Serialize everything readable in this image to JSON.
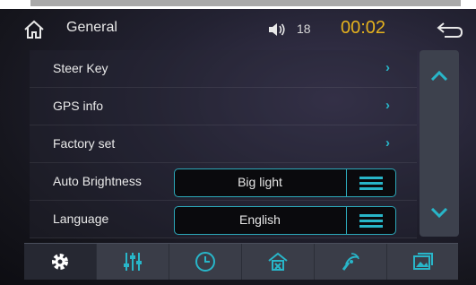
{
  "header": {
    "title": "General",
    "volume_level": "18",
    "clock": "00:02"
  },
  "settings": {
    "rows": [
      {
        "label": "Steer Key"
      },
      {
        "label": "GPS info"
      },
      {
        "label": "Factory set"
      },
      {
        "label": "Auto Brightness",
        "value": "Big light"
      },
      {
        "label": "Language",
        "value": "English"
      }
    ]
  },
  "colors": {
    "accent": "#28b6c9",
    "clock": "#e5b21e",
    "dock": "#3a3d48"
  },
  "dock": {
    "items": [
      "gear-icon",
      "equalizer-icon",
      "clock-icon",
      "navigation-icon",
      "antenna-icon",
      "gallery-icon"
    ],
    "active": "gear-icon"
  }
}
